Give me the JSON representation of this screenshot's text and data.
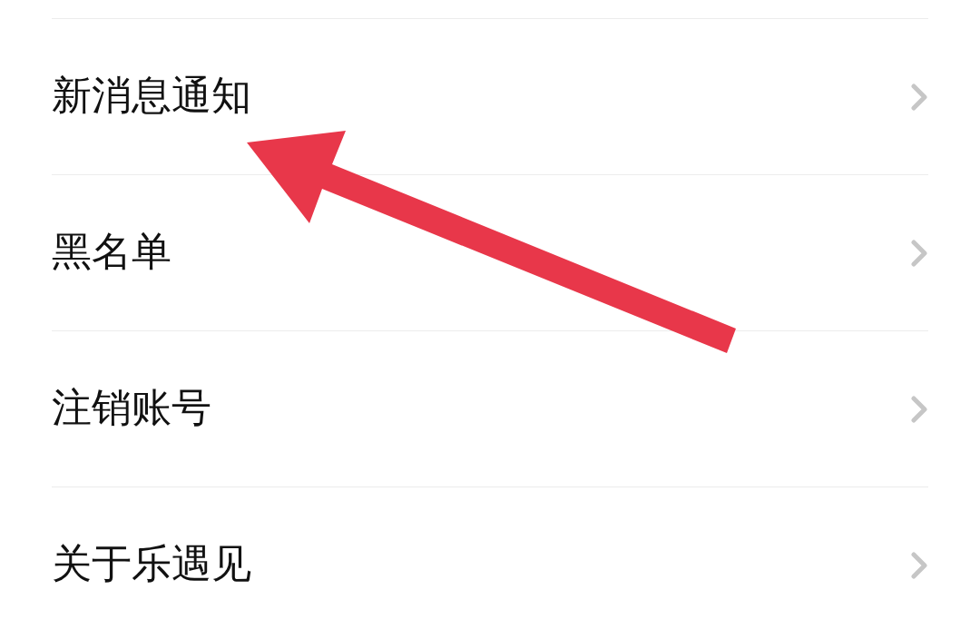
{
  "settings_list": {
    "items": [
      {
        "label": "新消息通知"
      },
      {
        "label": "黑名单"
      },
      {
        "label": "注销账号"
      },
      {
        "label": "关于乐遇见"
      }
    ]
  }
}
